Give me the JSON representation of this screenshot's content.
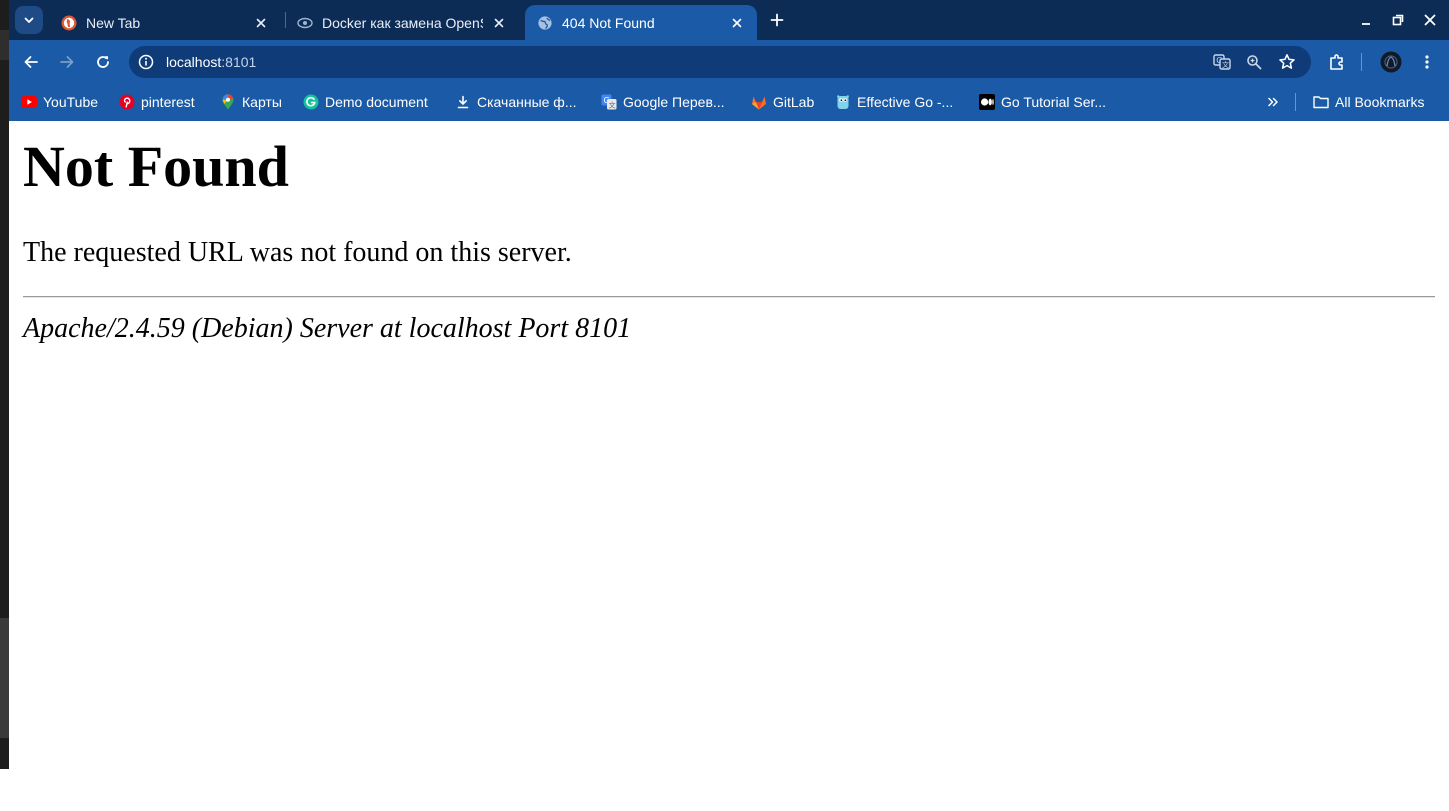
{
  "browser": {
    "tabs": [
      {
        "title": "New Tab",
        "icon": "duckduckgo-icon",
        "active": false
      },
      {
        "title": "Docker как замена OpenServer",
        "icon": "habr-icon",
        "active": false
      },
      {
        "title": "404 Not Found",
        "icon": "globe-icon",
        "active": true
      }
    ],
    "address_bar": {
      "host": "localhost",
      "port": ":8101"
    },
    "bookmarks": [
      {
        "label": "YouTube",
        "icon": "youtube-icon",
        "color": "#ff0000"
      },
      {
        "label": "pinterest",
        "icon": "pinterest-icon",
        "color": "#e60023"
      },
      {
        "label": "Карты",
        "icon": "maps-pin-icon",
        "color": "#34a853"
      },
      {
        "label": "Demo document",
        "icon": "grammarly-icon",
        "color": "#15c39a"
      },
      {
        "label": "Скачанные ф...",
        "icon": "download-icon",
        "color": "#ffffff"
      },
      {
        "label": "Google Перев...",
        "icon": "google-translate-icon",
        "color": "#4285f4"
      },
      {
        "label": "GitLab",
        "icon": "gitlab-icon",
        "color": "#fc6d26"
      },
      {
        "label": "Effective Go -...",
        "icon": "go-gopher-icon",
        "color": "#7fd3ed"
      },
      {
        "label": "Go Tutorial Ser...",
        "icon": "medium-icon",
        "color": "#000000"
      }
    ],
    "all_bookmarks_label": "All Bookmarks"
  },
  "page": {
    "heading": "Not Found",
    "message": "The requested URL was not found on this server.",
    "server_signature": "Apache/2.4.59 (Debian) Server at localhost Port 8101"
  },
  "colors": {
    "tabstrip": "#0d2c55",
    "toolbar": "#1b5aa6",
    "omnibox": "#0f3c78",
    "page_background": "#ffffff"
  }
}
